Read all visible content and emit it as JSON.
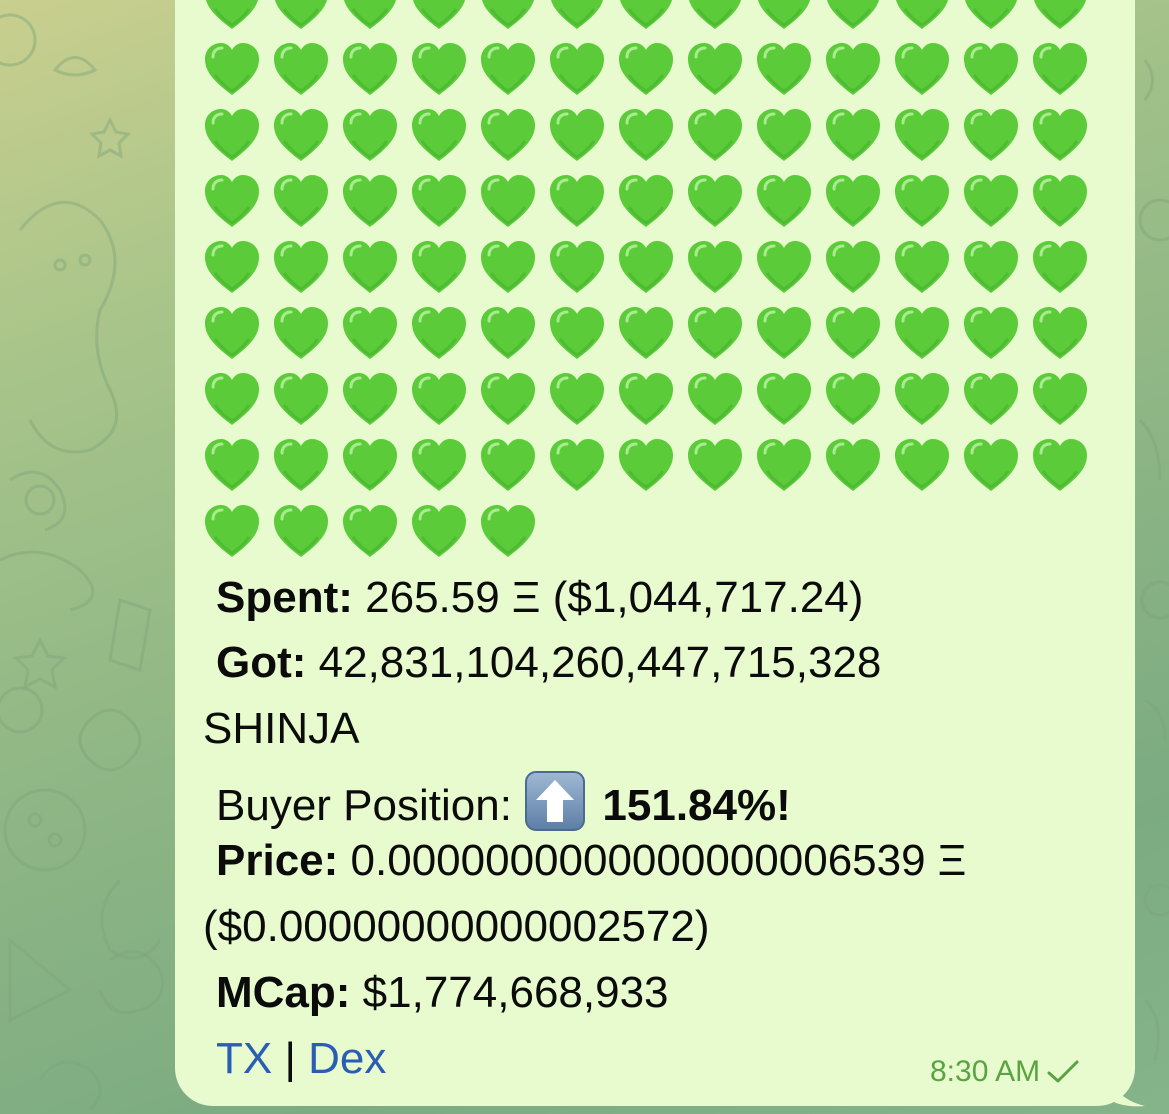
{
  "message": {
    "hearts": {
      "emoji_name": "green-heart-icon",
      "color": "#5bcb3a",
      "rows": [
        13,
        13,
        13,
        13,
        13,
        13,
        13,
        13,
        5
      ]
    },
    "spent": {
      "label": "Spent:",
      "value": "265.59 Ξ ($1,044,717.24)"
    },
    "got": {
      "label": "Got:",
      "value": "42,831,104,260,447,715,328",
      "token": "SHINJA"
    },
    "buyer_position": {
      "label": "Buyer Position:",
      "icon": "up-arrow-icon",
      "value": "151.84%!"
    },
    "price": {
      "label": "Price:",
      "value": "0.0000000000000000006539 Ξ",
      "usd": "($0.00000000000002572)"
    },
    "mcap": {
      "label": "MCap:",
      "value": "$1,774,668,933"
    },
    "links": {
      "tx": "TX",
      "separator": "|",
      "dex": "Dex"
    },
    "time": "8:30 AM",
    "status_icon": "check-icon"
  },
  "colors": {
    "bubble": "#e7fbce",
    "link": "#2b5db5",
    "time": "#5aa342"
  }
}
